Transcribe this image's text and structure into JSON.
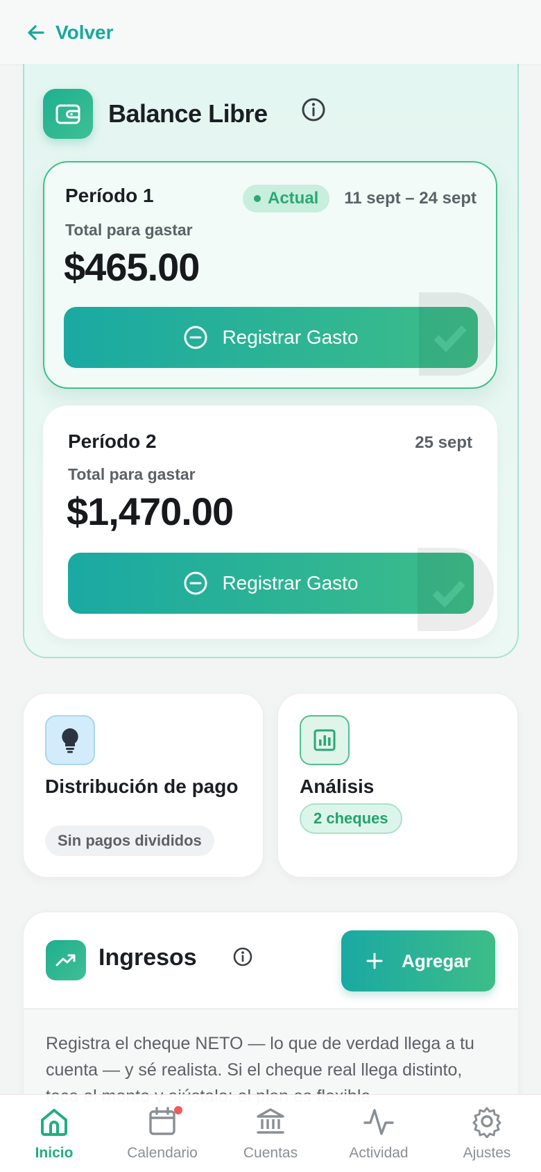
{
  "header": {
    "back_label": "Volver"
  },
  "balance": {
    "title": "Balance Libre",
    "periods": [
      {
        "name": "Período 1",
        "badge": "Actual",
        "dates": "11 sept – 24 sept",
        "total_label": "Total para gastar",
        "amount": "$465.00",
        "button_label": "Registrar Gasto"
      },
      {
        "name": "Período 2",
        "dates": "25 sept",
        "total_label": "Total para gastar",
        "amount": "$1,470.00",
        "button_label": "Registrar Gasto"
      }
    ]
  },
  "tiles": [
    {
      "title": "Distribución de pago",
      "chip": "Sin pagos divididos",
      "icon": "lightbulb-icon"
    },
    {
      "title": "Análisis",
      "chip": "2 cheques",
      "icon": "chart-icon"
    }
  ],
  "ingresos": {
    "title": "Ingresos",
    "add_label": "Agregar",
    "description": "Registra el cheque NETO — lo que de verdad llega a tu cuenta — y sé realista. Si el cheque real llega distinto, toca el monto y ajústalo: el plan es flexible."
  },
  "nav": [
    {
      "label": "Inicio",
      "icon": "home-icon",
      "active": true
    },
    {
      "label": "Calendario",
      "icon": "calendar-icon",
      "badge": true
    },
    {
      "label": "Cuentas",
      "icon": "bank-icon"
    },
    {
      "label": "Actividad",
      "icon": "activity-icon"
    },
    {
      "label": "Ajustes",
      "icon": "gear-icon"
    }
  ],
  "colors": {
    "accent": "#16a99a",
    "accent_green": "#3dbd88",
    "notif": "#ef5a5a"
  }
}
